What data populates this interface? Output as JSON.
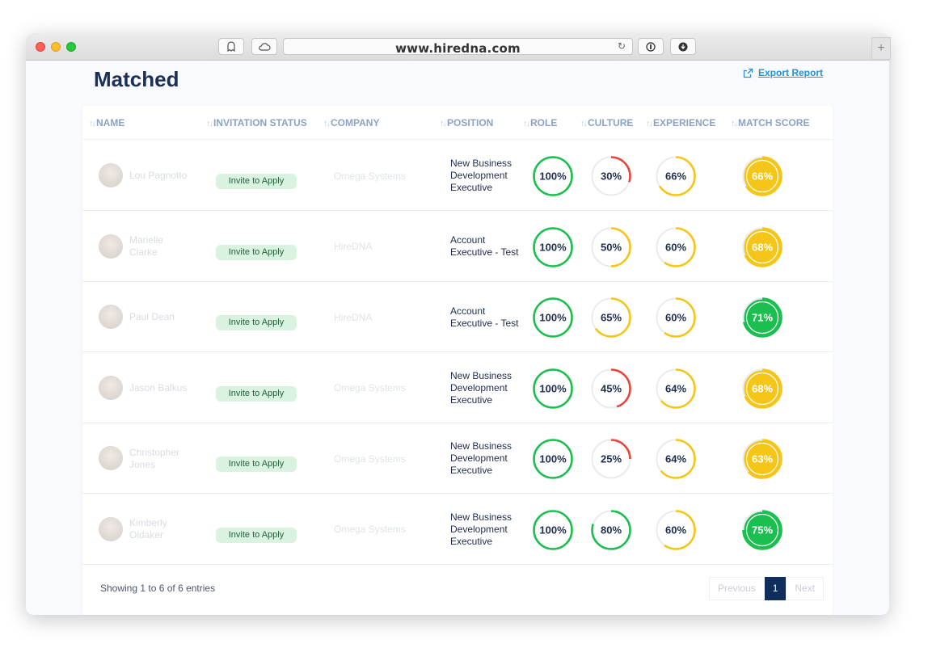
{
  "browser": {
    "url": "www.hiredna.com"
  },
  "page": {
    "title": "Matched",
    "export_label": "Export Report"
  },
  "table": {
    "headers": [
      "NAME",
      "INVITATION STATUS",
      "COMPANY",
      "POSITION",
      "ROLE",
      "CULTURE",
      "EXPERIENCE",
      "MATCH SCORE"
    ],
    "rows": [
      {
        "name": "Lou Pagnotto",
        "status": "Invite to Apply",
        "company": "Omega Systems",
        "position": "New Business Development Executive",
        "role": "100%",
        "culture": "30%",
        "experience": "66%",
        "match": "66%"
      },
      {
        "name": "Marielle Clarke",
        "status": "Invite to Apply",
        "company": "HireDNA",
        "position": "Account Executive - Test",
        "role": "100%",
        "culture": "50%",
        "experience": "60%",
        "match": "68%"
      },
      {
        "name": "Paul Dean",
        "status": "Invite to Apply",
        "company": "HireDNA",
        "position": "Account Executive - Test",
        "role": "100%",
        "culture": "65%",
        "experience": "60%",
        "match": "71%"
      },
      {
        "name": "Jason Balkus",
        "status": "Invite to Apply",
        "company": "Omega Systems",
        "position": "New Business Development Executive",
        "role": "100%",
        "culture": "45%",
        "experience": "64%",
        "match": "68%"
      },
      {
        "name": "Christopher Jones",
        "status": "Invite to Apply",
        "company": "Omega Systems",
        "position": "New Business Development Executive",
        "role": "100%",
        "culture": "25%",
        "experience": "64%",
        "match": "63%"
      },
      {
        "name": "Kimberly Oldaker",
        "status": "Invite to Apply",
        "company": "Omega Systems",
        "position": "New Business Development Executive",
        "role": "100%",
        "culture": "80%",
        "experience": "60%",
        "match": "75%"
      }
    ]
  },
  "footer": {
    "info": "Showing 1 to 6 of 6 entries",
    "previous": "Previous",
    "page": "1",
    "next": "Next"
  },
  "colors": {
    "green": "#1bbf4f",
    "yellow": "#f5c518",
    "red": "#e8453c",
    "track": "#e9ebef",
    "text": "#1e2d4e"
  }
}
